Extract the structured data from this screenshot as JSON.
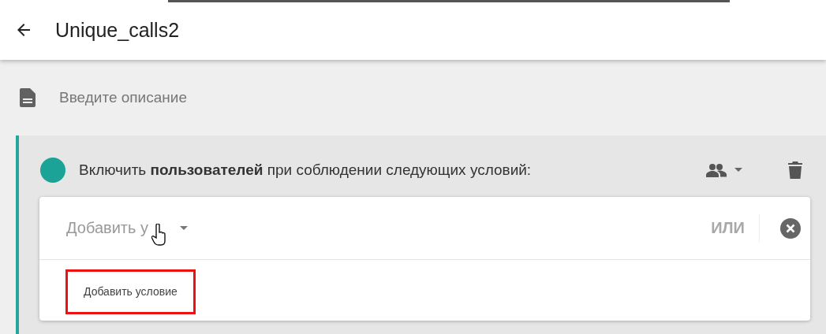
{
  "header": {
    "title": "Unique_calls2"
  },
  "description": {
    "placeholder": "Введите описание"
  },
  "rule": {
    "text": "Включить **пользователей** при соблюдении следующих условий:",
    "condition": {
      "placeholder": "Добавить у",
      "or_label": "ИЛИ",
      "options": [
        {
          "label": "Добавить условие",
          "highlighted": true
        }
      ]
    }
  }
}
